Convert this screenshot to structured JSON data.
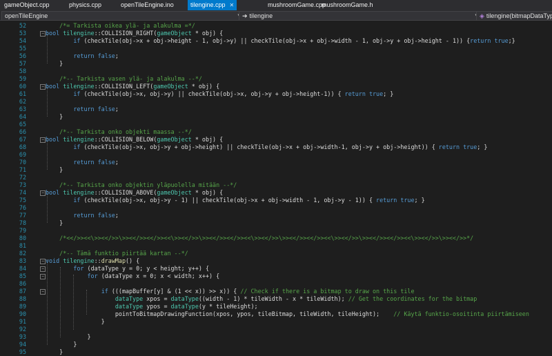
{
  "tabs": [
    {
      "label": "gameObject.cpp",
      "active": false
    },
    {
      "label": "physics.cpp",
      "active": false
    },
    {
      "label": "openTileEngine.ino",
      "active": false
    },
    {
      "label": "tilengine.cpp",
      "active": true,
      "close": "✕"
    },
    {
      "label": "mushroomGame.cpp",
      "active": false
    },
    {
      "label": "mushroomGame.h",
      "active": false
    }
  ],
  "nav": {
    "project": "openTileEngine",
    "scope": "tilengine",
    "member": "tilengine(bitmapDataType"
  },
  "colors": {
    "keyword": "#569cd6",
    "type": "#4ec9b0",
    "comment": "#57a64a",
    "function": "#dcdcaa",
    "text": "#dcdcdc",
    "linenum": "#2b91af",
    "accent": "#007acc"
  },
  "lines": [
    {
      "n": "52",
      "fold": "",
      "segs": [
        [
          "cm",
          "    /*= Tarkista oikea ylä- ja alakulma =*/"
        ]
      ]
    },
    {
      "n": "53",
      "fold": "−",
      "segs": [
        [
          "kw",
          "bool"
        ],
        [
          "pl",
          " "
        ],
        [
          "ty",
          "tilengine"
        ],
        [
          "pl",
          "::COLLISION_RIGHT("
        ],
        [
          "ty",
          "gameObject"
        ],
        [
          "pl",
          " * obj) {"
        ]
      ]
    },
    {
      "n": "54",
      "fold": "",
      "segs": [
        [
          "pl",
          "        "
        ],
        [
          "kw",
          "if"
        ],
        [
          "pl",
          " (checkTile(obj->x + obj->height - 1, obj->y) || checkTile(obj->x + obj->width - 1, obj->y + obj->height - 1)) {"
        ],
        [
          "kw",
          "return true"
        ],
        [
          "pl",
          ";}"
        ]
      ]
    },
    {
      "n": "55",
      "fold": "",
      "segs": [
        [
          "pl",
          ""
        ]
      ]
    },
    {
      "n": "56",
      "fold": "",
      "segs": [
        [
          "pl",
          "        "
        ],
        [
          "kw",
          "return false"
        ],
        [
          "pl",
          ";"
        ]
      ]
    },
    {
      "n": "57",
      "fold": "",
      "segs": [
        [
          "pl",
          "    }"
        ]
      ]
    },
    {
      "n": "58",
      "fold": "",
      "segs": [
        [
          "pl",
          ""
        ]
      ]
    },
    {
      "n": "59",
      "fold": "",
      "segs": [
        [
          "cm",
          "    /*-- Tarkista vasen ylä- ja alakulma --*/"
        ]
      ]
    },
    {
      "n": "60",
      "fold": "−",
      "segs": [
        [
          "kw",
          "bool"
        ],
        [
          "pl",
          " "
        ],
        [
          "ty",
          "tilengine"
        ],
        [
          "pl",
          "::COLLISION_LEFT("
        ],
        [
          "ty",
          "gameObject"
        ],
        [
          "pl",
          " * obj) {"
        ]
      ]
    },
    {
      "n": "61",
      "fold": "",
      "segs": [
        [
          "pl",
          "        "
        ],
        [
          "kw",
          "if"
        ],
        [
          "pl",
          " (checkTile(obj->x, obj->y) || checkTile(obj->x, obj->y + obj->height-1)) { "
        ],
        [
          "kw",
          "return true"
        ],
        [
          "pl",
          "; }"
        ]
      ]
    },
    {
      "n": "62",
      "fold": "",
      "segs": [
        [
          "pl",
          ""
        ]
      ]
    },
    {
      "n": "63",
      "fold": "",
      "segs": [
        [
          "pl",
          "        "
        ],
        [
          "kw",
          "return false"
        ],
        [
          "pl",
          ";"
        ]
      ]
    },
    {
      "n": "64",
      "fold": "",
      "segs": [
        [
          "pl",
          "    }"
        ]
      ]
    },
    {
      "n": "65",
      "fold": "",
      "segs": [
        [
          "pl",
          ""
        ]
      ]
    },
    {
      "n": "66",
      "fold": "",
      "segs": [
        [
          "cm",
          "    /*-- Tarkista onko objekti maassa --*/"
        ]
      ]
    },
    {
      "n": "67",
      "fold": "−",
      "segs": [
        [
          "kw",
          "bool"
        ],
        [
          "pl",
          " "
        ],
        [
          "ty",
          "tilengine"
        ],
        [
          "pl",
          "::COLLISION_BELOW("
        ],
        [
          "ty",
          "gameObject"
        ],
        [
          "pl",
          " * obj) {"
        ]
      ]
    },
    {
      "n": "68",
      "fold": "",
      "segs": [
        [
          "pl",
          "        "
        ],
        [
          "kw",
          "if"
        ],
        [
          "pl",
          " (checkTile(obj->x, obj->y + obj->height) || checkTile(obj->x + obj->width-1, obj->y + obj->height)) { "
        ],
        [
          "kw",
          "return true"
        ],
        [
          "pl",
          "; }"
        ]
      ]
    },
    {
      "n": "69",
      "fold": "",
      "segs": [
        [
          "pl",
          ""
        ]
      ]
    },
    {
      "n": "70",
      "fold": "",
      "segs": [
        [
          "pl",
          "        "
        ],
        [
          "kw",
          "return false"
        ],
        [
          "pl",
          ";"
        ]
      ]
    },
    {
      "n": "71",
      "fold": "",
      "segs": [
        [
          "pl",
          "    }"
        ]
      ]
    },
    {
      "n": "72",
      "fold": "",
      "segs": [
        [
          "pl",
          ""
        ]
      ]
    },
    {
      "n": "73",
      "fold": "",
      "segs": [
        [
          "cm",
          "    /*-- Tarkista onko objektin yläpuolella mitään --*/"
        ]
      ]
    },
    {
      "n": "74",
      "fold": "−",
      "segs": [
        [
          "kw",
          "bool"
        ],
        [
          "pl",
          " "
        ],
        [
          "ty",
          "tilengine"
        ],
        [
          "pl",
          "::COLLISION_ABOVE("
        ],
        [
          "ty",
          "gameObject"
        ],
        [
          "pl",
          " * obj) {"
        ]
      ]
    },
    {
      "n": "75",
      "fold": "",
      "segs": [
        [
          "pl",
          "        "
        ],
        [
          "kw",
          "if"
        ],
        [
          "pl",
          " (checkTile(obj->x, obj->y - 1) || checkTile(obj->x + obj->width - 1, obj->y - 1)) { "
        ],
        [
          "kw",
          "return true"
        ],
        [
          "pl",
          "; }"
        ]
      ]
    },
    {
      "n": "76",
      "fold": "",
      "segs": [
        [
          "pl",
          ""
        ]
      ]
    },
    {
      "n": "77",
      "fold": "",
      "segs": [
        [
          "pl",
          "        "
        ],
        [
          "kw",
          "return false"
        ],
        [
          "pl",
          ";"
        ]
      ]
    },
    {
      "n": "78",
      "fold": "",
      "segs": [
        [
          "pl",
          "    }"
        ]
      ]
    },
    {
      "n": "79",
      "fold": "",
      "segs": [
        [
          "pl",
          ""
        ]
      ]
    },
    {
      "n": "80",
      "fold": "",
      "segs": [
        [
          "cm",
          "    /*<</>><<\\>><</>>\\>><</>><</>><<\\>><</>>\\>><</>><</>><<\\>><</>>\\>><</>><</>><<\\>><</>>\\>><</>><</>><<\\>><</>>\\>><</>>*/"
        ]
      ]
    },
    {
      "n": "81",
      "fold": "",
      "segs": [
        [
          "pl",
          ""
        ]
      ]
    },
    {
      "n": "82",
      "fold": "",
      "segs": [
        [
          "cm",
          "    /*-- Tämä funktio piirtää kartan --*/"
        ]
      ]
    },
    {
      "n": "83",
      "fold": "−",
      "segs": [
        [
          "kw",
          "void"
        ],
        [
          "pl",
          " "
        ],
        [
          "ty",
          "tilengine"
        ],
        [
          "pl",
          "::"
        ],
        [
          "fn",
          "drawMap"
        ],
        [
          "pl",
          "() {"
        ]
      ]
    },
    {
      "n": "84",
      "fold": "−",
      "segs": [
        [
          "pl",
          "        "
        ],
        [
          "kw",
          "for"
        ],
        [
          "pl",
          " (dataType y = 0; y < height; y++) {"
        ]
      ]
    },
    {
      "n": "85",
      "fold": "−",
      "segs": [
        [
          "pl",
          "            "
        ],
        [
          "kw",
          "for"
        ],
        [
          "pl",
          " (dataType x = 0; x < width; x++) {"
        ]
      ]
    },
    {
      "n": "86",
      "fold": "",
      "segs": [
        [
          "pl",
          ""
        ]
      ]
    },
    {
      "n": "87",
      "fold": "−",
      "segs": [
        [
          "pl",
          "                "
        ],
        [
          "kw",
          "if"
        ],
        [
          "pl",
          " (((mapBuffer[y] & (1 << x)) >> x)) { "
        ],
        [
          "cm",
          "// Check if there is a bitmap to draw on this tile"
        ]
      ]
    },
    {
      "n": "88",
      "fold": "",
      "segs": [
        [
          "pl",
          "                    "
        ],
        [
          "ty",
          "dataType"
        ],
        [
          "pl",
          " xpos = "
        ],
        [
          "ty",
          "dataType"
        ],
        [
          "pl",
          "((width - 1) * tileWidth - x * tileWidth); "
        ],
        [
          "cm",
          "// Get the coordinates for the bitmap"
        ]
      ]
    },
    {
      "n": "89",
      "fold": "",
      "segs": [
        [
          "pl",
          "                    "
        ],
        [
          "ty",
          "dataType"
        ],
        [
          "pl",
          " ypos = "
        ],
        [
          "ty",
          "dataType"
        ],
        [
          "pl",
          "(y * tileHeight);"
        ]
      ]
    },
    {
      "n": "90",
      "fold": "",
      "segs": [
        [
          "pl",
          "                    pointToBitmapDrawingFunction(xpos, ypos, tileBitmap, tileWidth, tileHeight);    "
        ],
        [
          "cm",
          "// Käytä funktio-osoitinta piirtämiseen"
        ]
      ]
    },
    {
      "n": "91",
      "fold": "",
      "segs": [
        [
          "pl",
          "                }"
        ]
      ]
    },
    {
      "n": "92",
      "fold": "",
      "segs": [
        [
          "pl",
          ""
        ]
      ]
    },
    {
      "n": "93",
      "fold": "",
      "segs": [
        [
          "pl",
          "            }"
        ]
      ]
    },
    {
      "n": "94",
      "fold": "",
      "segs": [
        [
          "pl",
          "        }"
        ]
      ]
    },
    {
      "n": "95",
      "fold": "",
      "segs": [
        [
          "pl",
          "    }"
        ]
      ]
    }
  ]
}
